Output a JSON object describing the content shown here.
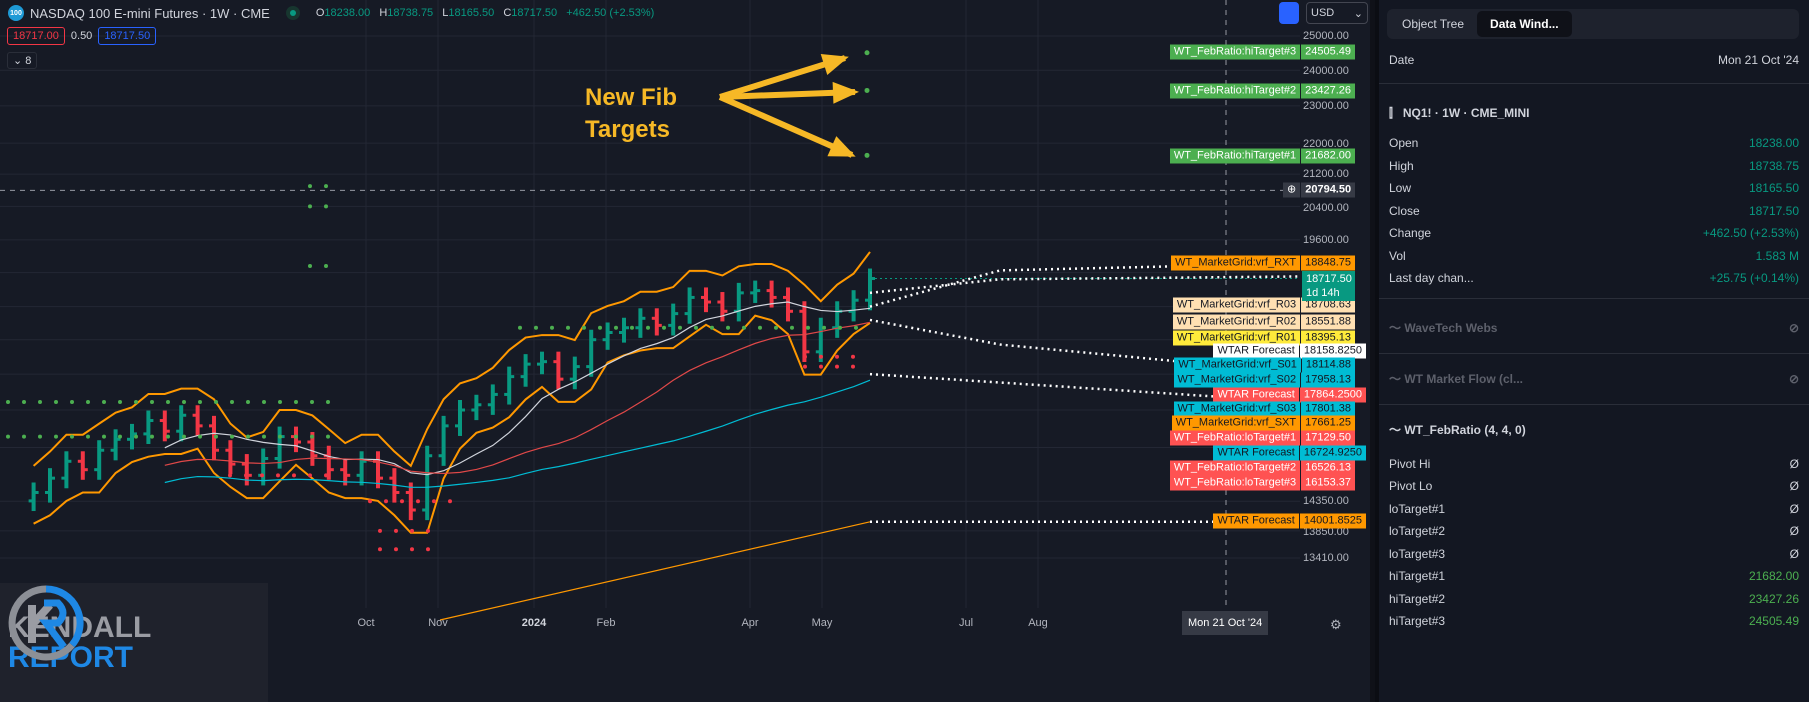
{
  "header": {
    "logo_text": "100",
    "title": "NASDAQ 100 E-mini Futures · 1W · CME",
    "ohlc": {
      "o_label": "O",
      "o": "18238.00",
      "h_label": "H",
      "h": "18738.75",
      "l_label": "L",
      "l": "18165.50",
      "c_label": "C",
      "c": "18717.50",
      "change": "+462.50 (+2.53%)"
    },
    "bid": "18717.00",
    "spread": "0.50",
    "ask": "18717.50",
    "indicators_count": "8",
    "currency": "USD"
  },
  "annotation": {
    "line1": "New Fib",
    "line2": "Targets"
  },
  "logo": {
    "line1": "KENDALL",
    "line2": "REPORT"
  },
  "price_axis": [
    "25000.00",
    "24000.00",
    "23000.00",
    "22000.00",
    "21200.00",
    "20400.00",
    "19600.00",
    "14350.00",
    "13850.00",
    "13410.00"
  ],
  "price_labels": [
    {
      "name": "WT_FebRatio:hiTarget#3",
      "value": "24505.49",
      "bg": "#4caf50",
      "fg": "#ffffff"
    },
    {
      "name": "WT_FebRatio:hiTarget#2",
      "value": "23427.26",
      "bg": "#4caf50",
      "fg": "#ffffff"
    },
    {
      "name": "WT_FebRatio:hiTarget#1",
      "value": "21682.00",
      "bg": "#4caf50",
      "fg": "#ffffff"
    },
    {
      "name": "WT_MarketGrid:vrf_RXT",
      "value": "18848.75",
      "bg": "#ff9800",
      "fg": "#131722"
    },
    {
      "name": "WT_MarketGrid:vrf_R03",
      "value": "18708.63",
      "bg": "#ffe0b2",
      "fg": "#131722"
    },
    {
      "name": "WT_MarketGrid:vrf_R02",
      "value": "18551.88",
      "bg": "#ffe0b2",
      "fg": "#131722"
    },
    {
      "name": "WT_MarketGrid:vrf_R01",
      "value": "18395.13",
      "bg": "#ffeb3b",
      "fg": "#131722"
    },
    {
      "name": "WTAR Forecast",
      "value": "18158.8250",
      "bg": "#ffffff",
      "fg": "#131722"
    },
    {
      "name": "WT_MarketGrid:vrf_S01",
      "value": "18114.88",
      "bg": "#00bcd4",
      "fg": "#131722"
    },
    {
      "name": "WT_MarketGrid:vrf_S02",
      "value": "17958.13",
      "bg": "#00bcd4",
      "fg": "#131722"
    },
    {
      "name": "WTAR Forecast",
      "value": "17864.2500",
      "bg": "#ff5252",
      "fg": "#ffffff"
    },
    {
      "name": "WT_MarketGrid:vrf_S03",
      "value": "17801.38",
      "bg": "#00bcd4",
      "fg": "#131722"
    },
    {
      "name": "WT_MarketGrid:vrf_SXT",
      "value": "17661.25",
      "bg": "#ff9800",
      "fg": "#131722"
    },
    {
      "name": "WT_FebRatio:loTarget#1",
      "value": "17129.50",
      "bg": "#ff5252",
      "fg": "#ffffff"
    },
    {
      "name": "WTAR Forecast",
      "value": "16724.9250",
      "bg": "#00bcd4",
      "fg": "#131722"
    },
    {
      "name": "WT_FebRatio:loTarget#2",
      "value": "16526.13",
      "bg": "#ff5252",
      "fg": "#ffffff"
    },
    {
      "name": "WT_FebRatio:loTarget#3",
      "value": "16153.37",
      "bg": "#ff5252",
      "fg": "#ffffff"
    },
    {
      "name": "WTAR Forecast",
      "value": "14001.8525",
      "bg": "#ff9800",
      "fg": "#131722"
    }
  ],
  "crosshair_price": "20794.50",
  "last_price": {
    "value": "18717.50",
    "countdown": "1d 14h",
    "bg": "#089981"
  },
  "time_axis": [
    "Oct",
    "Nov",
    "2024",
    "Feb",
    "Apr",
    "May",
    "Jul",
    "Aug"
  ],
  "crosshair_date": "Mon 21 Oct '24",
  "chart_data": {
    "type": "candlestick",
    "timeframe": "1W",
    "start": "2023-06",
    "closes": [
      14500,
      14750,
      15050,
      14900,
      15250,
      15450,
      15550,
      15800,
      15600,
      15900,
      15700,
      15250,
      15000,
      14800,
      15100,
      15500,
      15400,
      15150,
      14900,
      14800,
      15050,
      14750,
      14500,
      14200,
      15150,
      15700,
      16000,
      16100,
      16300,
      16650,
      16900,
      16950,
      16600,
      16850,
      17400,
      17550,
      17650,
      17850,
      17700,
      17950,
      18300,
      18200,
      18000,
      18400,
      18450,
      18300,
      18000,
      17150,
      17650,
      18000,
      18240,
      18717.5
    ],
    "fib_targets": [
      21682.0,
      23427.26,
      24505.49
    ]
  },
  "panel": {
    "tabs": [
      "Object Tree",
      "Data Wind..."
    ],
    "date_label": "Date",
    "date": "Mon 21 Oct '24",
    "symbol": "NQ1! · 1W · CME_MINI",
    "rows": [
      {
        "k": "Open",
        "v": "18238.00"
      },
      {
        "k": "High",
        "v": "18738.75"
      },
      {
        "k": "Low",
        "v": "18165.50"
      },
      {
        "k": "Close",
        "v": "18717.50"
      },
      {
        "k": "Change",
        "v": "+462.50 (+2.53%)"
      },
      {
        "k": "Vol",
        "v": "1.583 M"
      },
      {
        "k": "Last day chan...",
        "v": "+25.75 (+0.14%)"
      }
    ],
    "ind1": "WaveTech Webs",
    "ind2": "WT Market Flow (cl...",
    "ind3": "WT_FebRatio (4, 4, 0)",
    "feb_rows": [
      {
        "k": "Pivot Hi",
        "v": "Ø"
      },
      {
        "k": "Pivot Lo",
        "v": "Ø"
      },
      {
        "k": "loTarget#1",
        "v": "Ø"
      },
      {
        "k": "loTarget#2",
        "v": "Ø"
      },
      {
        "k": "loTarget#3",
        "v": "Ø"
      },
      {
        "k": "hiTarget#1",
        "v": "21682.00"
      },
      {
        "k": "hiTarget#2",
        "v": "23427.26"
      },
      {
        "k": "hiTarget#3",
        "v": "24505.49"
      }
    ]
  }
}
